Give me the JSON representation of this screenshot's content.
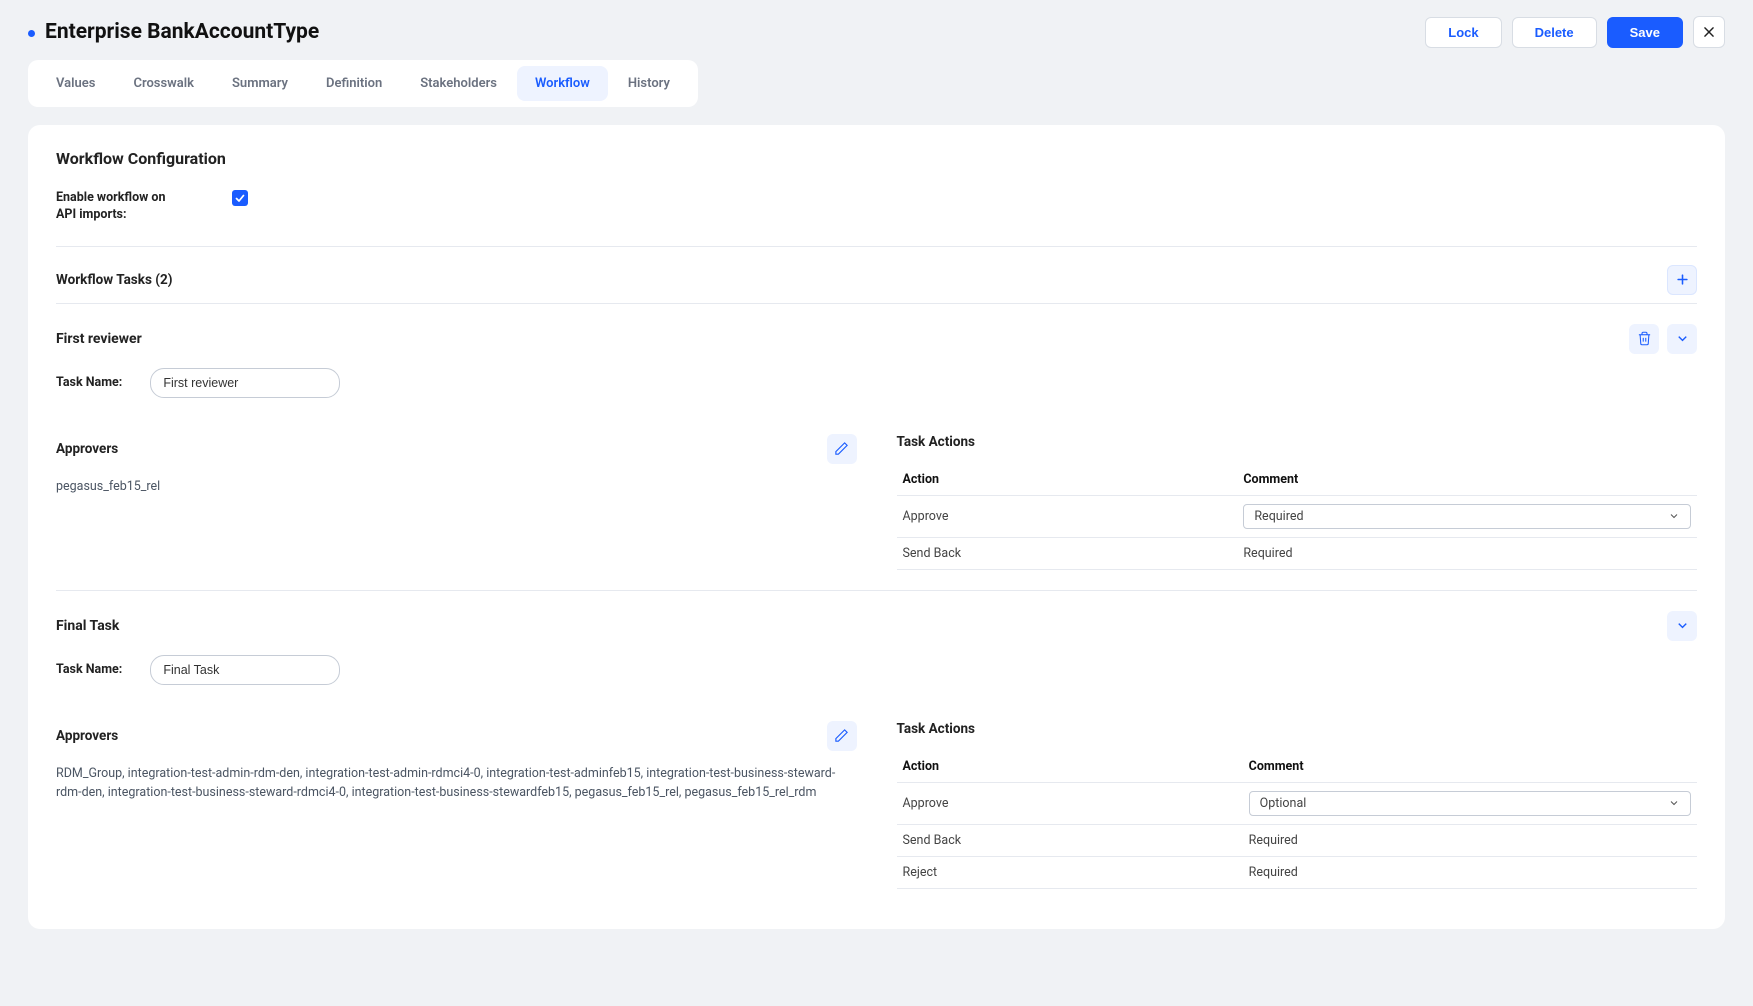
{
  "header": {
    "title": "Enterprise BankAccountType",
    "lock": "Lock",
    "delete": "Delete",
    "save": "Save"
  },
  "tabs": {
    "values": "Values",
    "crosswalk": "Crosswalk",
    "summary": "Summary",
    "definition": "Definition",
    "stakeholders": "Stakeholders",
    "workflow": "Workflow",
    "history": "History",
    "active": "workflow"
  },
  "workflow": {
    "section_title": "Workflow Configuration",
    "enable_label": "Enable workflow on API imports:",
    "tasks_label": "Workflow Tasks (2)",
    "task_name_label": "Task Name:"
  },
  "approvers_label": "Approvers",
  "task_actions_label": "Task Actions",
  "actions_headers": {
    "action": "Action",
    "comment": "Comment"
  },
  "tasks": [
    {
      "title": "First reviewer",
      "name_value": "First reviewer",
      "approvers": "pegasus_feb15_rel",
      "actions": [
        {
          "action": "Approve",
          "comment": "Required",
          "editable": true
        },
        {
          "action": "Send Back",
          "comment": "Required",
          "editable": false
        }
      ],
      "show_delete": true
    },
    {
      "title": "Final Task",
      "name_value": "Final Task",
      "approvers": "RDM_Group, integration-test-admin-rdm-den, integration-test-admin-rdmci4-0, integration-test-adminfeb15, integration-test-business-steward-rdm-den, integration-test-business-steward-rdmci4-0, integration-test-business-stewardfeb15, pegasus_feb15_rel, pegasus_feb15_rel_rdm",
      "actions": [
        {
          "action": "Approve",
          "comment": "Optional",
          "editable": true
        },
        {
          "action": "Send Back",
          "comment": "Required",
          "editable": false
        },
        {
          "action": "Reject",
          "comment": "Required",
          "editable": false
        }
      ],
      "show_delete": false
    }
  ]
}
